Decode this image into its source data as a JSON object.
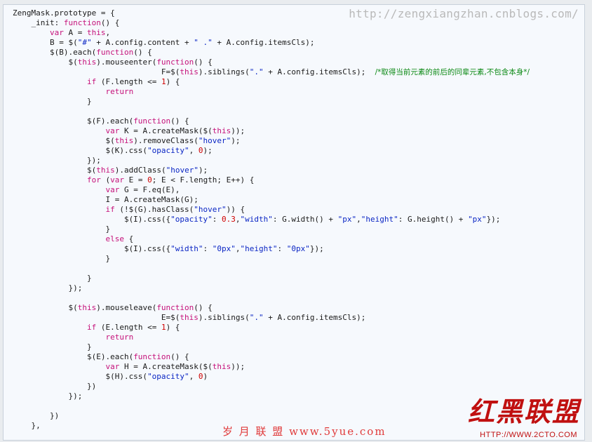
{
  "watermark": {
    "url": "http://zengxiangzhan.cnblogs.com/",
    "bottom_text": "岁 月 联 盟  www.5yue.com",
    "logo_text": "红黑联盟",
    "logo_url": "HTTP://WWW.2CTO.COM"
  },
  "colors": {
    "keyword": "#c5117a",
    "string": "#0b26c4",
    "number": "#d00000",
    "comment": "#0d8a16"
  },
  "code_lines": [
    [
      [
        "p",
        "ZengMask.prototype = {"
      ]
    ],
    [
      [
        "p",
        "    _init: "
      ],
      [
        "k",
        "function"
      ],
      [
        "p",
        "() {"
      ]
    ],
    [
      [
        "p",
        "        "
      ],
      [
        "k",
        "var"
      ],
      [
        "p",
        " A = "
      ],
      [
        "k",
        "this"
      ],
      [
        "p",
        ","
      ]
    ],
    [
      [
        "p",
        "        B = $("
      ],
      [
        "s",
        "\"#\""
      ],
      [
        "p",
        " + A.config.content + "
      ],
      [
        "s",
        "\" .\""
      ],
      [
        "p",
        " + A.config.itemsCls);"
      ]
    ],
    [
      [
        "p",
        "        $(B).each("
      ],
      [
        "k",
        "function"
      ],
      [
        "p",
        "() {"
      ]
    ],
    [
      [
        "p",
        "            $("
      ],
      [
        "k",
        "this"
      ],
      [
        "p",
        ").mouseenter("
      ],
      [
        "k",
        "function"
      ],
      [
        "p",
        "() {"
      ]
    ],
    [
      [
        "p",
        "                                F=$("
      ],
      [
        "k",
        "this"
      ],
      [
        "p",
        ").siblings("
      ],
      [
        "s",
        "\".\""
      ],
      [
        "p",
        " + A.config.itemsCls);  "
      ],
      [
        "c",
        "/*取得当前元素的前后的同辈元素,不包含本身*/"
      ]
    ],
    [
      [
        "p",
        "                "
      ],
      [
        "k",
        "if"
      ],
      [
        "p",
        " (F.length <= "
      ],
      [
        "n",
        "1"
      ],
      [
        "p",
        ") {"
      ]
    ],
    [
      [
        "p",
        "                    "
      ],
      [
        "k",
        "return"
      ]
    ],
    [
      [
        "p",
        "                }"
      ]
    ],
    [
      [
        "p",
        ""
      ]
    ],
    [
      [
        "p",
        "                $(F).each("
      ],
      [
        "k",
        "function"
      ],
      [
        "p",
        "() {"
      ]
    ],
    [
      [
        "p",
        "                    "
      ],
      [
        "k",
        "var"
      ],
      [
        "p",
        " K = A.createMask($("
      ],
      [
        "k",
        "this"
      ],
      [
        "p",
        "));"
      ]
    ],
    [
      [
        "p",
        "                    $("
      ],
      [
        "k",
        "this"
      ],
      [
        "p",
        ").removeClass("
      ],
      [
        "s",
        "\"hover\""
      ],
      [
        "p",
        ");"
      ]
    ],
    [
      [
        "p",
        "                    $(K).css("
      ],
      [
        "s",
        "\"opacity\""
      ],
      [
        "p",
        ", "
      ],
      [
        "n",
        "0"
      ],
      [
        "p",
        ");"
      ]
    ],
    [
      [
        "p",
        "                });"
      ]
    ],
    [
      [
        "p",
        "                $("
      ],
      [
        "k",
        "this"
      ],
      [
        "p",
        ").addClass("
      ],
      [
        "s",
        "\"hover\""
      ],
      [
        "p",
        ");"
      ]
    ],
    [
      [
        "p",
        "                "
      ],
      [
        "k",
        "for"
      ],
      [
        "p",
        " ("
      ],
      [
        "k",
        "var"
      ],
      [
        "p",
        " E = "
      ],
      [
        "n",
        "0"
      ],
      [
        "p",
        "; E < F.length; E++) {"
      ]
    ],
    [
      [
        "p",
        "                    "
      ],
      [
        "k",
        "var"
      ],
      [
        "p",
        " G = F.eq(E),"
      ]
    ],
    [
      [
        "p",
        "                    I = A.createMask(G);"
      ]
    ],
    [
      [
        "p",
        "                    "
      ],
      [
        "k",
        "if"
      ],
      [
        "p",
        " (!$(G).hasClass("
      ],
      [
        "s",
        "\"hover\""
      ],
      [
        "p",
        ")) {"
      ]
    ],
    [
      [
        "p",
        "                        $(I).css({"
      ],
      [
        "s",
        "\"opacity\""
      ],
      [
        "p",
        ": "
      ],
      [
        "n",
        "0.3"
      ],
      [
        "p",
        ","
      ],
      [
        "s",
        "\"width\""
      ],
      [
        "p",
        ": G.width() + "
      ],
      [
        "s",
        "\"px\""
      ],
      [
        "p",
        ","
      ],
      [
        "s",
        "\"height\""
      ],
      [
        "p",
        ": G.height() + "
      ],
      [
        "s",
        "\"px\""
      ],
      [
        "p",
        "});"
      ]
    ],
    [
      [
        "p",
        "                    }"
      ]
    ],
    [
      [
        "p",
        "                    "
      ],
      [
        "k",
        "else"
      ],
      [
        "p",
        " {"
      ]
    ],
    [
      [
        "p",
        "                        $(I).css({"
      ],
      [
        "s",
        "\"width\""
      ],
      [
        "p",
        ": "
      ],
      [
        "s",
        "\"0px\""
      ],
      [
        "p",
        ","
      ],
      [
        "s",
        "\"height\""
      ],
      [
        "p",
        ": "
      ],
      [
        "s",
        "\"0px\""
      ],
      [
        "p",
        "});"
      ]
    ],
    [
      [
        "p",
        "                    }"
      ]
    ],
    [
      [
        "p",
        ""
      ]
    ],
    [
      [
        "p",
        "                }"
      ]
    ],
    [
      [
        "p",
        "            });"
      ]
    ],
    [
      [
        "p",
        ""
      ]
    ],
    [
      [
        "p",
        "            $("
      ],
      [
        "k",
        "this"
      ],
      [
        "p",
        ").mouseleave("
      ],
      [
        "k",
        "function"
      ],
      [
        "p",
        "() {"
      ]
    ],
    [
      [
        "p",
        "                                E=$("
      ],
      [
        "k",
        "this"
      ],
      [
        "p",
        ").siblings("
      ],
      [
        "s",
        "\".\""
      ],
      [
        "p",
        " + A.config.itemsCls);"
      ]
    ],
    [
      [
        "p",
        "                "
      ],
      [
        "k",
        "if"
      ],
      [
        "p",
        " (E.length <= "
      ],
      [
        "n",
        "1"
      ],
      [
        "p",
        ") {"
      ]
    ],
    [
      [
        "p",
        "                    "
      ],
      [
        "k",
        "return"
      ]
    ],
    [
      [
        "p",
        "                }"
      ]
    ],
    [
      [
        "p",
        "                $(E).each("
      ],
      [
        "k",
        "function"
      ],
      [
        "p",
        "() {"
      ]
    ],
    [
      [
        "p",
        "                    "
      ],
      [
        "k",
        "var"
      ],
      [
        "p",
        " H = A.createMask($("
      ],
      [
        "k",
        "this"
      ],
      [
        "p",
        "));"
      ]
    ],
    [
      [
        "p",
        "                    $(H).css("
      ],
      [
        "s",
        "\"opacity\""
      ],
      [
        "p",
        ", "
      ],
      [
        "n",
        "0"
      ],
      [
        "p",
        ")"
      ]
    ],
    [
      [
        "p",
        "                })"
      ]
    ],
    [
      [
        "p",
        "            });"
      ]
    ],
    [
      [
        "p",
        ""
      ]
    ],
    [
      [
        "p",
        "        })"
      ]
    ],
    [
      [
        "p",
        "    },"
      ]
    ]
  ]
}
